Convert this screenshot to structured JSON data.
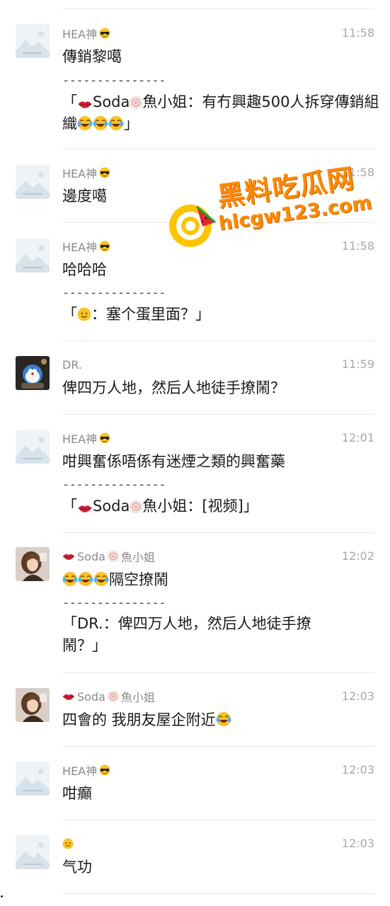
{
  "colors": {
    "divider": "#e8e8e8",
    "name": "#8a8a8a",
    "time": "#a8a8a8",
    "watermark": "#ff8a00"
  },
  "watermark": {
    "title": "黑料吃瓜网",
    "url": "hlcgw123.com"
  },
  "messages": [
    {
      "sender": "HEA神",
      "sender_emoji": "sunglasses-face-icon",
      "time": "11:58",
      "text": "傳銷黎噶",
      "dashes": "---------------",
      "quote_prefix": "「",
      "quote_sender": "Soda",
      "quote_sender2": "魚小姐",
      "quote_text": "：有冇興趣500人拆穿傳銷組織",
      "quote_suffix": "」"
    },
    {
      "sender": "HEA神",
      "sender_emoji": "sunglasses-face-icon",
      "time": "11:58",
      "text": "邊度噶"
    },
    {
      "sender": "HEA神",
      "sender_emoji": "sunglasses-face-icon",
      "time": "11:58",
      "text": "哈哈哈",
      "dashes": "---------------",
      "quote_prefix": "「",
      "quote_text": "：塞个蛋里面？」"
    },
    {
      "sender": "DR.",
      "time": "11:59",
      "text": "俾四万人地，然后人地徒手撩鬧？"
    },
    {
      "sender": "HEA神",
      "sender_emoji": "sunglasses-face-icon",
      "time": "12:01",
      "text": "咁興奮係唔係有迷煙之類的興奮藥",
      "dashes": "---------------",
      "quote_prefix": "「",
      "quote_sender": "Soda",
      "quote_sender2": "魚小姐",
      "quote_text": "：[视频]」"
    },
    {
      "sender": "Soda",
      "sender2": "魚小姐",
      "time": "12:02",
      "text": "隔空撩鬧",
      "dashes": "---------------",
      "quote_text": "「DR.：俾四万人地，然后人地徒手撩鬧？」"
    },
    {
      "sender": "Soda",
      "sender2": "魚小姐",
      "time": "12:03",
      "text": "四會的 我朋友屋企附近"
    },
    {
      "sender": "HEA神",
      "sender_emoji": "sunglasses-face-icon",
      "time": "12:03",
      "text": "咁癲"
    },
    {
      "sender": "",
      "sender_emoji": "smiling-face-icon",
      "time": "12:03",
      "text": "气功"
    }
  ]
}
